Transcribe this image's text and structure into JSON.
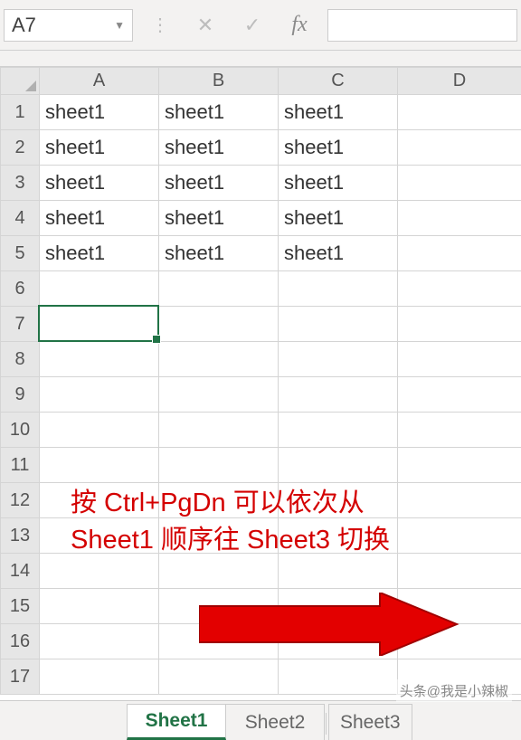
{
  "nameBox": {
    "value": "A7"
  },
  "columns": [
    "A",
    "B",
    "C",
    "D"
  ],
  "rowCount": 17,
  "cells": {
    "r0": {
      "c0": "sheet1",
      "c1": "sheet1",
      "c2": "sheet1"
    },
    "r1": {
      "c0": "sheet1",
      "c1": "sheet1",
      "c2": "sheet1"
    },
    "r2": {
      "c0": "sheet1",
      "c1": "sheet1",
      "c2": "sheet1"
    },
    "r3": {
      "c0": "sheet1",
      "c1": "sheet1",
      "c2": "sheet1"
    },
    "r4": {
      "c0": "sheet1",
      "c1": "sheet1",
      "c2": "sheet1"
    }
  },
  "activeCell": {
    "row": 7,
    "col": "A"
  },
  "annotation": {
    "line1": "按 Ctrl+PgDn 可以依次从",
    "line2": "Sheet1 顺序往 Sheet3 切换"
  },
  "sheetTabs": {
    "items": [
      "Sheet1",
      "Sheet2",
      "Sheet3"
    ],
    "activeIndex": 0
  },
  "fxIcons": {
    "cancel": "✕",
    "enter": "✓",
    "fx": "fx"
  },
  "watermark": "头条@我是小辣椒"
}
